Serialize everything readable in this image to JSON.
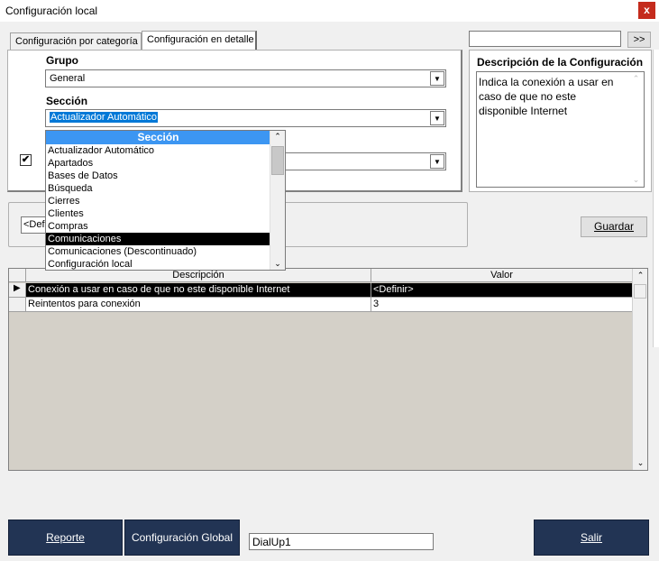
{
  "window": {
    "title": "Configuración local",
    "close_glyph": "x"
  },
  "tabs": [
    {
      "label": "Configuración por categoría"
    },
    {
      "label": "Configuración en detalle"
    }
  ],
  "form": {
    "grupo_label": "Grupo",
    "grupo_value": "General",
    "seccion_label": "Sección",
    "seccion_value": "Actualizador Automático",
    "checkbox_checked": true,
    "checkbox_glyph": "✔",
    "definir_value": "<Definir>"
  },
  "dropdown": {
    "header": "Sección",
    "items": [
      "Actualizador Automático",
      "Apartados",
      "Bases de Datos",
      "Búsqueda",
      "Cierres",
      "Clientes",
      "Compras",
      "Comunicaciones",
      "Comunicaciones (Descontinuado)",
      "Configuración local"
    ],
    "selected_index": 7
  },
  "search": {
    "value": "",
    "button_label": ">>"
  },
  "description": {
    "title": "Descripción de la Configuración",
    "text": "Indica la conexión a usar en caso de que no este disponible Internet"
  },
  "buttons": {
    "guardar": "Guardar",
    "reporte": "Reporte",
    "configuracion_global": "Configuración Global",
    "salir": "Salir"
  },
  "grid": {
    "columns": [
      "Descripción",
      "Valor"
    ],
    "rows": [
      {
        "descripcion": "Conexión a usar en caso de que no este disponible Internet",
        "valor": "<Definir>",
        "selected": true
      },
      {
        "descripcion": "Reintentos para conexión",
        "valor": "3",
        "selected": false
      }
    ]
  },
  "footer": {
    "dialup_value": "DialUp1"
  },
  "colors": {
    "accent_navy": "#223454",
    "dropdown_header": "#3c96f2",
    "selection": "#0078d7",
    "close_red": "#c42b1c"
  }
}
